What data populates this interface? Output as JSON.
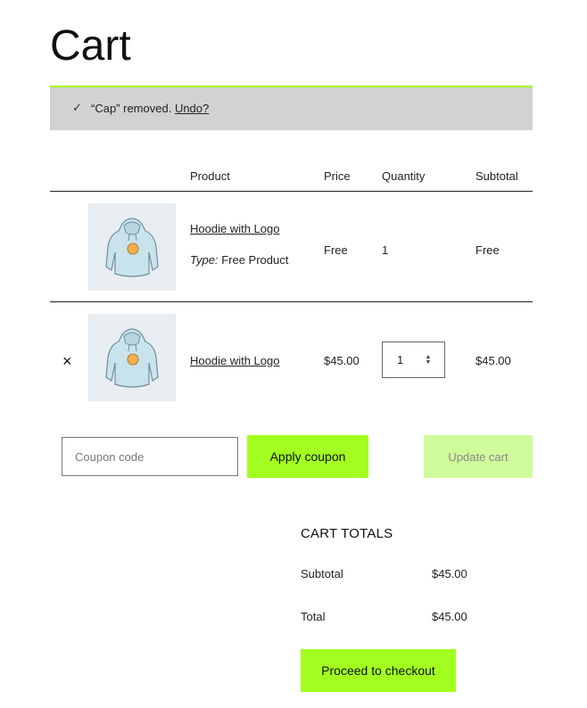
{
  "page": {
    "title": "Cart"
  },
  "notice": {
    "quote_item": "“Cap” removed.",
    "undo_label": "Undo?",
    "icon": "check-icon"
  },
  "table": {
    "headers": {
      "product": "Product",
      "price": "Price",
      "quantity": "Quantity",
      "subtotal": "Subtotal"
    },
    "rows": [
      {
        "name": "Hoodie with Logo",
        "meta_label": "Type:",
        "meta_value": "Free Product",
        "price": "Free",
        "quantity": "1",
        "subtotal": "Free"
      },
      {
        "name": "Hoodie with Logo",
        "remove_icon": "×",
        "price": "$45.00",
        "quantity": "1",
        "subtotal": "$45.00"
      }
    ]
  },
  "actions": {
    "coupon_placeholder": "Coupon code",
    "apply_label": "Apply coupon",
    "update_label": "Update cart"
  },
  "totals": {
    "title": "CART TOTALS",
    "subtotal_label": "Subtotal",
    "subtotal_value": "$45.00",
    "total_label": "Total",
    "total_value": "$45.00",
    "checkout_label": "Proceed to checkout"
  },
  "colors": {
    "accent": "#a2ff1f",
    "accent_disabled": "#cffb9a",
    "notice_bg": "#d2d2d2"
  }
}
